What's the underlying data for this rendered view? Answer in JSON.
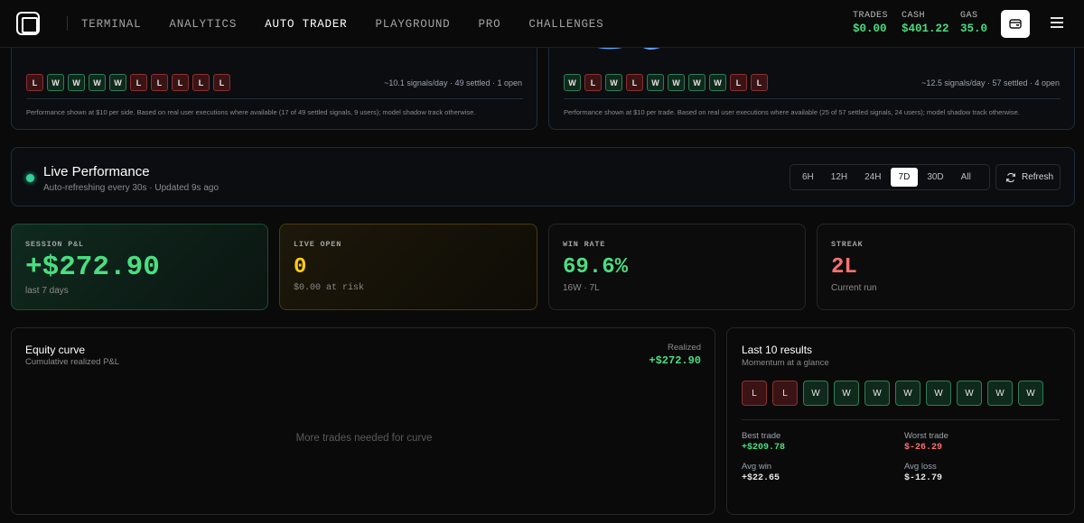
{
  "nav": {
    "links": [
      "TERMINAL",
      "ANALYTICS",
      "AUTO TRADER",
      "PLAYGROUND",
      "PRO",
      "CHALLENGES"
    ],
    "active_link": "AUTO TRADER",
    "stats": [
      {
        "label": "TRADES",
        "value": "$0.00"
      },
      {
        "label": "CASH",
        "value": "$401.22"
      },
      {
        "label": "GAS",
        "value": "35.0"
      }
    ],
    "icons": {
      "logo": "square-logo",
      "wallet": "wallet-icon",
      "menu": "menu-icon"
    }
  },
  "top_cards": [
    {
      "results": [
        "L",
        "W",
        "W",
        "W",
        "W",
        "L",
        "L",
        "L",
        "L",
        "L"
      ],
      "meta": "~10.1 signals/day · 49 settled · 1 open",
      "note": "Performance shown at $10 per side. Based on real user executions where available (17 of 49 settled signals, 9 users); model shadow track otherwise."
    },
    {
      "results": [
        "W",
        "L",
        "W",
        "L",
        "W",
        "W",
        "W",
        "W",
        "L",
        "L"
      ],
      "meta": "~12.5 signals/day · 57 settled · 4 open",
      "note": "Performance shown at $10 per trade. Based on real user executions where available (25 of 57 settled signals, 24 users); model shadow track otherwise."
    }
  ],
  "live": {
    "title": "Live Performance",
    "subtitle": "Auto-refreshing every 30s · Updated 9s ago",
    "ranges": [
      "6H",
      "12H",
      "24H",
      "7D",
      "30D",
      "All"
    ],
    "active_range": "7D",
    "refresh_label": "Refresh"
  },
  "kpis": {
    "session": {
      "label": "SESSION P&L",
      "value": "+$272.90",
      "sub": "last 7 days"
    },
    "open": {
      "label": "LIVE OPEN",
      "value": "0",
      "sub": "$0.00 at risk"
    },
    "winrate": {
      "label": "WIN RATE",
      "value": "69.6%",
      "sub": "16W · 7L"
    },
    "streak": {
      "label": "STREAK",
      "value": "2L",
      "sub": "Current run"
    }
  },
  "equity": {
    "title": "Equity curve",
    "subtitle": "Cumulative realized P&L",
    "realized_label": "Realized",
    "realized_value": "+$272.90",
    "empty_message": "More trades needed for curve"
  },
  "last10": {
    "title": "Last 10 results",
    "subtitle": "Momentum at a glance",
    "results": [
      "L",
      "L",
      "W",
      "W",
      "W",
      "W",
      "W",
      "W",
      "W",
      "W"
    ],
    "best_label": "Best trade",
    "best_value": "+$209.78",
    "worst_label": "Worst trade",
    "worst_value": "$-26.29",
    "avg_win_label": "Avg win",
    "avg_win_value": "+$22.65",
    "avg_loss_label": "Avg loss",
    "avg_loss_value": "$-12.79"
  },
  "colors": {
    "green": "#4ade80",
    "red": "#f87171",
    "amber": "#facc15",
    "accent_dot": "#34d399"
  }
}
